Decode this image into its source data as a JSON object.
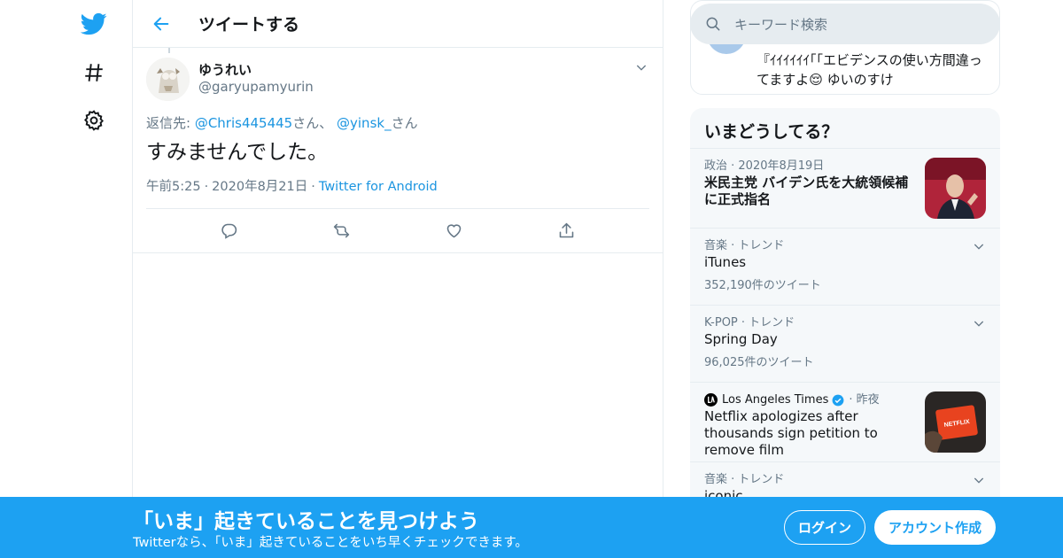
{
  "nav": {
    "icons": [
      "twitter-bird-icon",
      "hashtag-icon",
      "gear-icon"
    ],
    "brand_color": "#1da1f2"
  },
  "header": {
    "title": "ツイートする"
  },
  "tweet": {
    "author_name": "ゆうれい",
    "author_handle": "@garyupamyurin",
    "reply_prefix": "返信先: ",
    "reply_user1": "@Chris445445",
    "reply_suffix1": "さん、",
    "reply_user2": "@yinsk_",
    "reply_suffix2": "さん",
    "text": "すみませんでした。",
    "time": "午前5:25",
    "date": "2020年8月21日",
    "source": "Twitter for Android",
    "separator": "·"
  },
  "search": {
    "placeholder": "キーワード検索"
  },
  "prev_tweet": {
    "text": "『ｲｲｲｲｲｲ｢｢エビデンスの使い方間違ってますよ😌 ゆいのすけ"
  },
  "trends": {
    "title": "いまどうしてる？",
    "items": [
      {
        "meta": "政治 · 2020年8月19日",
        "name": "米民主党 バイデン氏を大統領候補に正式指名",
        "count": ""
      },
      {
        "meta": "音楽 · トレンド",
        "name": "iTunes",
        "count": "352,190件のツイート"
      },
      {
        "meta": "K-POP · トレンド",
        "name": "Spring Day",
        "count": "96,025件のツイート"
      },
      {
        "meta": "Los Angeles Times",
        "meta_time": "· 昨夜",
        "name": "Netflix apologizes after thousands sign petition to remove film",
        "count": ""
      },
      {
        "meta": "音楽 · トレンド",
        "name": "iconic",
        "count": ""
      }
    ]
  },
  "banner": {
    "title": "「いま」起きていることを見つけよう",
    "subtitle": "Twitterなら、「いま」起きていることをいち早くチェックできます。",
    "login": "ログイン",
    "signup": "アカウント作成",
    "color": "#1da1f2"
  }
}
